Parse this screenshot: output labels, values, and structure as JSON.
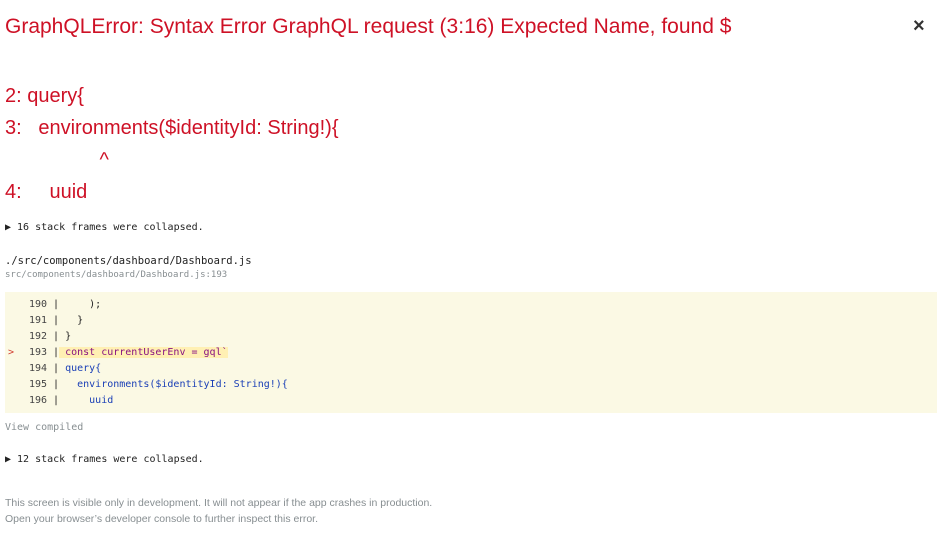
{
  "error": {
    "title": "GraphQLError: Syntax Error GraphQL request (3:16) Expected Name, found $",
    "close_label": "×",
    "message_lines": [
      "2: query{",
      "3:   environments($identityId: String!){",
      "                 ^",
      "4:     uuid"
    ]
  },
  "stack_collapsed_1": "▶ 16 stack frames were collapsed.",
  "source": {
    "file": "./src/components/dashboard/Dashboard.js",
    "location": "src/components/dashboard/Dashboard.js:193",
    "lines": [
      {
        "num": "190",
        "sep": " |",
        "text": "     );"
      },
      {
        "num": "191",
        "sep": " |",
        "text": "   }"
      },
      {
        "num": "192",
        "sep": " |",
        "text": " }"
      },
      {
        "num": "193",
        "sep": " |",
        "text": " const currentUserEnv = gql`"
      },
      {
        "num": "194",
        "sep": " |",
        "text": " query{"
      },
      {
        "num": "195",
        "sep": " |",
        "text": "   environments($identityId: String!){"
      },
      {
        "num": "196",
        "sep": " |",
        "text": "     uuid"
      }
    ],
    "highlight_marker": ">",
    "view_compiled": "View compiled"
  },
  "stack_collapsed_2": "▶ 12 stack frames were collapsed.",
  "footer": {
    "line1": "This screen is visible only in development. It will not appear if the app crashes in production.",
    "line2": "Open your browser’s developer console to further inspect this error."
  },
  "colors": {
    "error_red": "#ce1126",
    "code_bg": "#fbf9e4",
    "muted_gray": "#878e91"
  }
}
